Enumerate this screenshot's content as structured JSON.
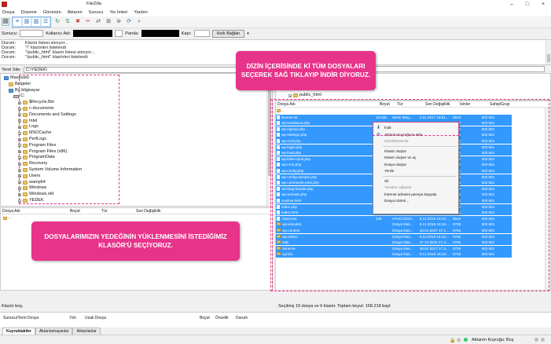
{
  "window": {
    "title": "FileZilla"
  },
  "menu": [
    "Dosya",
    "Düzenle",
    "Görünüm",
    "Aktarım",
    "Sunucu",
    "Yer İmleri",
    "Yardım"
  ],
  "quickconnect": {
    "host_label": "Sunucu:",
    "user_label": "Kullanıcı Adı:",
    "pass_label": "Parola:",
    "port_label": "Kapı:",
    "button": "Hızlı Bağlan"
  },
  "log": [
    {
      "k": "Durum:",
      "v": "Klasör listesi alınıyor..."
    },
    {
      "k": "Durum:",
      "v": "\"/\" klasörleri listelendi"
    },
    {
      "k": "Durum:",
      "v": "\"/public_html\" klasör listesi alınıyor..."
    },
    {
      "k": "Durum:",
      "v": "\"/public_html\" klasörleri listelendi"
    }
  ],
  "local": {
    "site_label": "Yerel Site:",
    "path": "C:\\YEDEK\\",
    "tree": [
      {
        "label": "Masaüstü",
        "icon": "pc",
        "indent": 0
      },
      {
        "label": "Belgeler",
        "icon": "folder",
        "indent": 1
      },
      {
        "label": "Bu bilgisayar",
        "icon": "pc",
        "indent": 1
      },
      {
        "label": "C:",
        "icon": "drive",
        "indent": 2
      },
      {
        "label": "$Recycle.Bin",
        "icon": "folder",
        "indent": 3
      },
      {
        "label": "c-documents",
        "icon": "folder",
        "indent": 3
      },
      {
        "label": "Documents and Settings",
        "icon": "folder",
        "indent": 3
      },
      {
        "label": "Intel",
        "icon": "folder",
        "indent": 3
      },
      {
        "label": "Logs",
        "icon": "folder",
        "indent": 3
      },
      {
        "label": "MSOCache",
        "icon": "folder",
        "indent": 3
      },
      {
        "label": "PerfLogs",
        "icon": "folder",
        "indent": 3
      },
      {
        "label": "Program Files",
        "icon": "folder",
        "indent": 3
      },
      {
        "label": "Program Files (x86)",
        "icon": "folder",
        "indent": 3
      },
      {
        "label": "ProgramData",
        "icon": "folder",
        "indent": 3
      },
      {
        "label": "Recovery",
        "icon": "folder",
        "indent": 3
      },
      {
        "label": "System Volume Information",
        "icon": "folder",
        "indent": 3
      },
      {
        "label": "Users",
        "icon": "folder",
        "indent": 3
      },
      {
        "label": "wamp64",
        "icon": "folder",
        "indent": 3
      },
      {
        "label": "Windows",
        "icon": "folder",
        "indent": 3
      },
      {
        "label": "Windows.old",
        "icon": "folder",
        "indent": 3
      },
      {
        "label": "YEDEK",
        "icon": "folder",
        "indent": 3
      }
    ],
    "columns": [
      "Dosya Adı",
      "Boyut",
      "Tür",
      "Son Değişiklik"
    ],
    "files": [
      ".."
    ],
    "status": "Klasör boş."
  },
  "remote": {
    "tree_item": "public_html",
    "columns": [
      "Dosya Adı",
      "Boyut",
      "Tür",
      "Son Değişiklik",
      "İzinler",
      "Sahip/Grup"
    ],
    "files": [
      {
        "name": "..",
        "size": "",
        "type": "",
        "date": "",
        "perm": "",
        "owner": "",
        "folder": true
      },
      {
        "name": "license.txt",
        "size": "19.935",
        "type": "Metin Belg...",
        "date": "2.01.2017 18:51...",
        "perm": "0644",
        "owner": "603 601"
      },
      {
        "name": "wp-trackback.php",
        "size": "",
        "type": "",
        "date": "",
        "perm": "0644",
        "owner": "603 601"
      },
      {
        "name": "wp-signup.php",
        "size": "",
        "type": "",
        "date": "",
        "perm": "0644",
        "owner": "603 601"
      },
      {
        "name": "wp-settings.php",
        "size": "",
        "type": "",
        "date": "",
        "perm": "0644",
        "owner": "603 601"
      },
      {
        "name": "wp-mail.php",
        "size": "",
        "type": "",
        "date": "",
        "perm": "0644",
        "owner": "603 601"
      },
      {
        "name": "wp-login.php",
        "size": "",
        "type": "",
        "date": "",
        "perm": "0644",
        "owner": "603 601"
      },
      {
        "name": "wp-load.php",
        "size": "",
        "type": "",
        "date": "",
        "perm": "0644",
        "owner": "603 601"
      },
      {
        "name": "wp-links-opml.php",
        "size": "",
        "type": "",
        "date": "",
        "perm": "0644",
        "owner": "603 601"
      },
      {
        "name": "wp-cron.php",
        "size": "",
        "type": "",
        "date": "",
        "perm": "0644",
        "owner": "603 601"
      },
      {
        "name": "wp-config.php",
        "size": "",
        "type": "",
        "date": "",
        "perm": "0644",
        "owner": "603 601"
      },
      {
        "name": "wp-config-sample.php",
        "size": "",
        "type": "",
        "date": "",
        "perm": "0644",
        "owner": "603 601"
      },
      {
        "name": "wp-comments-post.php",
        "size": "",
        "type": "",
        "date": "",
        "perm": "0644",
        "owner": "603 601"
      },
      {
        "name": "wp-blog-header.php",
        "size": "",
        "type": "",
        "date": "",
        "perm": "0644",
        "owner": "603 601"
      },
      {
        "name": "wp-activate.php",
        "size": "",
        "type": "",
        "date": "",
        "perm": "0644",
        "owner": "603 601"
      },
      {
        "name": "readme.html",
        "size": "7.433",
        "type": "JetBrains P...",
        "date": "11.01.2017 17:4...",
        "perm": "0644",
        "owner": "603 601"
      },
      {
        "name": "index.php",
        "size": "418",
        "type": "JetBrains P...",
        "date": "24.09.2013 23:1...",
        "perm": "0644",
        "owner": "603 601"
      },
      {
        "name": "index.html",
        "size": "7.822",
        "type": "HTML_ Do...",
        "date": "26.11.2016 19:1...",
        "perm": "0644",
        "owner": "603 601"
      },
      {
        "name": ".htaccess",
        "size": "236",
        "type": "HTACCESS...",
        "date": "9.12.2016 18:16:...",
        "perm": "0644",
        "owner": "603 601"
      },
      {
        "name": "wp-includes",
        "size": "",
        "type": "Dosya klas...",
        "date": "9.12.2016 18:15:...",
        "perm": "0755",
        "owner": "603 601"
      },
      {
        "name": "wp-content",
        "size": "",
        "type": "Dosya klas...",
        "date": "18.01.2017 17:1...",
        "perm": "0755",
        "owner": "603 601"
      },
      {
        "name": "wp-admin",
        "size": "",
        "type": "Dosya klas...",
        "date": "9.12.2016 18:15:...",
        "perm": "0755",
        "owner": "603 601"
      },
      {
        "name": "eski",
        "size": "",
        "type": "Dosya klas...",
        "date": "27.12.2016 17:4...",
        "perm": "0755",
        "owner": "603 601"
      },
      {
        "name": "deneme",
        "size": "",
        "type": "Dosya klas...",
        "date": "18.01.2017 17:4...",
        "perm": "0755",
        "owner": "603 601"
      },
      {
        "name": "cgi-bin",
        "size": "",
        "type": "Dosya klas...",
        "date": "9.12.2016 18:16:...",
        "perm": "0755",
        "owner": "603 601"
      }
    ],
    "status": "Seçilmiş 19 dosya ve 6 klasör. Toplam boyut: 158.218 bayt"
  },
  "context_menu": [
    {
      "label": "İndir",
      "enabled": true
    },
    {
      "label": "Aktarım kuyruğuna ekle",
      "enabled": true
    },
    {
      "label": "Gözat/Düzenle",
      "enabled": false
    },
    {
      "sep": true
    },
    {
      "label": "Klasör oluştur",
      "enabled": true
    },
    {
      "label": "Klasör oluştur ve aç",
      "enabled": true
    },
    {
      "label": "Dosya oluştur",
      "enabled": true
    },
    {
      "label": "Yenile",
      "enabled": true
    },
    {
      "sep": true
    },
    {
      "label": "Sil",
      "enabled": true
    },
    {
      "label": "Yeniden Adlandır",
      "enabled": false
    },
    {
      "label": "İnternet adresini panoya kopyala",
      "enabled": true
    },
    {
      "label": "Dosya izinleri...",
      "enabled": true
    }
  ],
  "queue": {
    "columns": [
      "Sunucu/Yerel Dosya",
      "Yön",
      "Uzak Dosya",
      "Boyut",
      "Öncelik",
      "Durum"
    ]
  },
  "tabs": [
    "Kuyruktakiler",
    "Aktarılamayanlar",
    "Aktarılanlar"
  ],
  "statusbar": {
    "queue": "Aktarım Kuyruğu: Boş"
  },
  "callouts": {
    "top": "DİZİN İÇERİSİNDE Kİ TÜM DOSYALARI SEÇEREK SAĞ TIKLAYIP İNDİR DİYORUZ.",
    "bottom": "DOSYALARIMIZIN YEDEĞİNİN YÜKLENMESİNİ İSTEDİĞİMİZ KLASÖR'Ü SEÇİYORUZ."
  },
  "colors": {
    "accent": "#e8338a",
    "selection": "#3399ff"
  }
}
